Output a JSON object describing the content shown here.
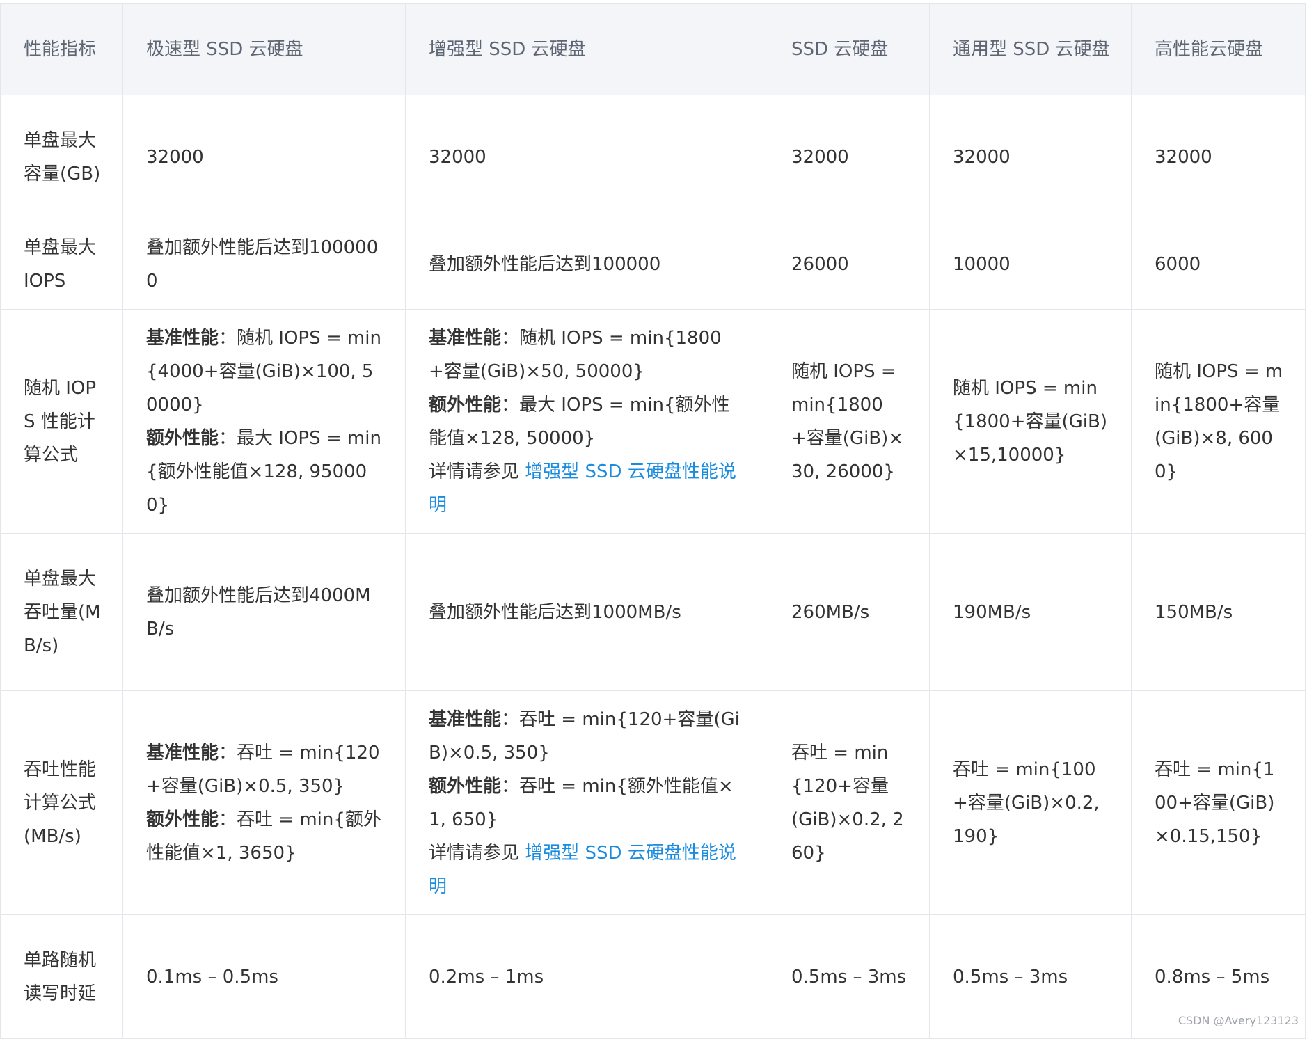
{
  "table": {
    "headers": [
      "性能指标",
      "极速型 SSD 云硬盘",
      "增强型 SSD 云硬盘",
      "SSD 云硬盘",
      "通用型 SSD 云硬盘",
      "高性能云硬盘"
    ],
    "rows": [
      [
        "单盘最大容量(GB)",
        "32000",
        "32000",
        "32000",
        "32000",
        "32000"
      ],
      [
        "单盘最大 IOPS",
        "叠加额外性能后达到1000000",
        "叠加额外性能后达到100000",
        "26000",
        "10000",
        "6000"
      ],
      [
        "随机 IOPS 性能计算公式",
        [
          [
            {
              "b": "基准性能"
            },
            "：随机 IOPS = min{4000+容量(GiB)×100, 50000}"
          ],
          [
            {
              "b": "额外性能"
            },
            "：最大 IOPS = min{额外性能值×128, 950000}"
          ]
        ],
        [
          [
            {
              "b": "基准性能"
            },
            "：随机 IOPS = min{1800+容量(GiB)×50, 50000}"
          ],
          [
            {
              "b": "额外性能"
            },
            "：最大 IOPS = min{额外性能值×128, 50000}"
          ],
          [
            "详情请参见 ",
            {
              "link": "增强型 SSD 云硬盘性能说明"
            }
          ]
        ],
        "随机 IOPS = min{1800+容量(GiB)×30, 26000}",
        "随机 IOPS = min{1800+容量(GiB)×15,10000}",
        "随机 IOPS = min{1800+容量(GiB)×8, 6000}"
      ],
      [
        "单盘最大吞吐量(MB/s)",
        "叠加额外性能后达到4000MB/s",
        "叠加额外性能后达到1000MB/s",
        "260MB/s",
        "190MB/s",
        "150MB/s"
      ],
      [
        "吞吐性能计算公式(MB/s)",
        [
          [
            {
              "b": "基准性能"
            },
            "：吞吐 = min{120+容量(GiB)×0.5, 350}"
          ],
          [
            {
              "b": "额外性能"
            },
            "：吞吐 = min{额外性能值×1, 3650}"
          ]
        ],
        [
          [
            {
              "b": "基准性能"
            },
            "：吞吐 = min{120+容量(GiB)×0.5, 350}"
          ],
          [
            {
              "b": "额外性能"
            },
            "：吞吐 = min{额外性能值×1, 650}"
          ],
          [
            "详情请参见 ",
            {
              "link": "增强型 SSD 云硬盘性能说明"
            }
          ]
        ],
        "吞吐 = min{120+容量(GiB)×0.2, 260}",
        "吞吐 = min{100+容量(GiB)×0.2, 190}",
        "吞吐 = min{100+容量(GiB)×0.15,150}"
      ],
      [
        "单路随机读写时延",
        "0.1ms – 0.5ms",
        "0.2ms – 1ms",
        "0.5ms – 3ms",
        "0.5ms – 3ms",
        "0.8ms – 5ms"
      ]
    ]
  },
  "watermark": "CSDN @Avery123123",
  "colors": {
    "header_bg": "#f3f5f8",
    "border": "#e3e6eb",
    "link": "#1a8ce0",
    "text": "#333333",
    "header_text": "#5e6673"
  }
}
